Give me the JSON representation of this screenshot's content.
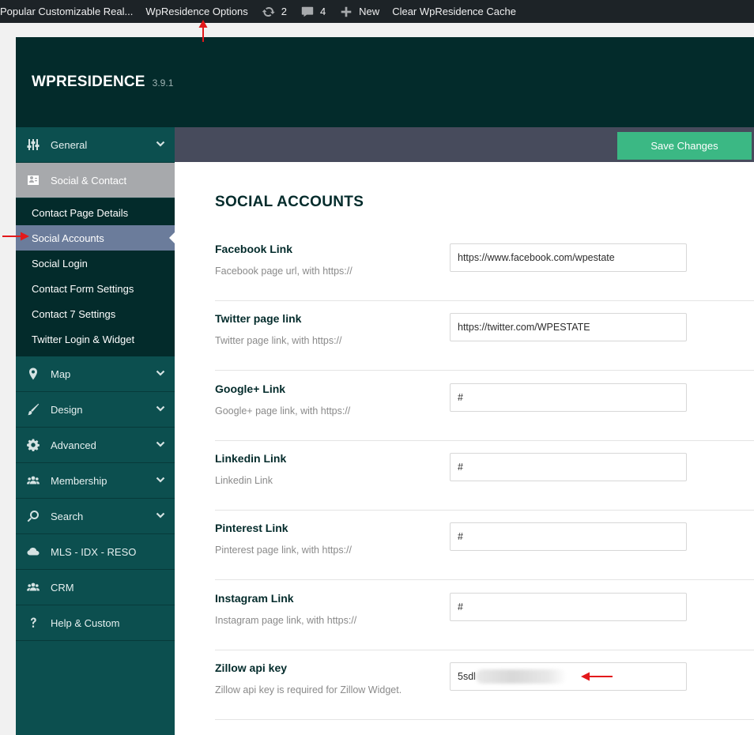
{
  "admin_bar": {
    "site_name": "Popular Customizable Real...",
    "options_label": "WpResidence Options",
    "updates_count": "2",
    "comments_count": "4",
    "new_label": "New",
    "cache_label": "Clear WpResidence Cache"
  },
  "header": {
    "brand": "WPRESIDENCE",
    "version": "3.9.1"
  },
  "sidebar": {
    "items": [
      {
        "label": "General",
        "icon": "sliders-icon"
      },
      {
        "label": "Social & Contact",
        "icon": "contact-card-icon"
      },
      {
        "label": "Map",
        "icon": "map-pin-icon"
      },
      {
        "label": "Design",
        "icon": "brush-icon"
      },
      {
        "label": "Advanced",
        "icon": "gear-icon"
      },
      {
        "label": "Membership",
        "icon": "users-icon"
      },
      {
        "label": "Search",
        "icon": "search-icon"
      },
      {
        "label": "MLS - IDX - RESO",
        "icon": "cloud-icon"
      },
      {
        "label": "CRM",
        "icon": "users-icon"
      },
      {
        "label": "Help & Custom",
        "icon": "question-icon"
      }
    ],
    "submenu": [
      "Contact Page Details",
      "Social Accounts",
      "Social Login",
      "Contact Form Settings",
      "Contact 7 Settings",
      "Twitter Login & Widget"
    ]
  },
  "toolbar": {
    "save_label": "Save Changes"
  },
  "section": {
    "title": "SOCIAL ACCOUNTS",
    "fields": [
      {
        "label": "Facebook Link",
        "desc": "Facebook page url, with https://",
        "value": "https://www.facebook.com/wpestate"
      },
      {
        "label": "Twitter page link",
        "desc": "Twitter page link, with https://",
        "value": "https://twitter.com/WPESTATE"
      },
      {
        "label": "Google+ Link",
        "desc": "Google+ page link, with https://",
        "value": "#"
      },
      {
        "label": "Linkedin Link",
        "desc": "Linkedin Link",
        "value": "#"
      },
      {
        "label": "Pinterest Link",
        "desc": "Pinterest page link, with https://",
        "value": "#"
      },
      {
        "label": "Instagram Link",
        "desc": "Instagram page link, with https://",
        "value": "#"
      },
      {
        "label": "Zillow api key",
        "desc": "Zillow api key is required for Zillow Widget.",
        "value": "5sdl"
      }
    ]
  },
  "colors": {
    "header_bg": "#032b2b",
    "sidebar_bg": "#0c4f4f",
    "active_item_bg": "#a7a9ac",
    "selected_sub_bg": "#6b7c9b",
    "save_button": "#3bb884",
    "annotation_arrow": "#e3191b"
  }
}
